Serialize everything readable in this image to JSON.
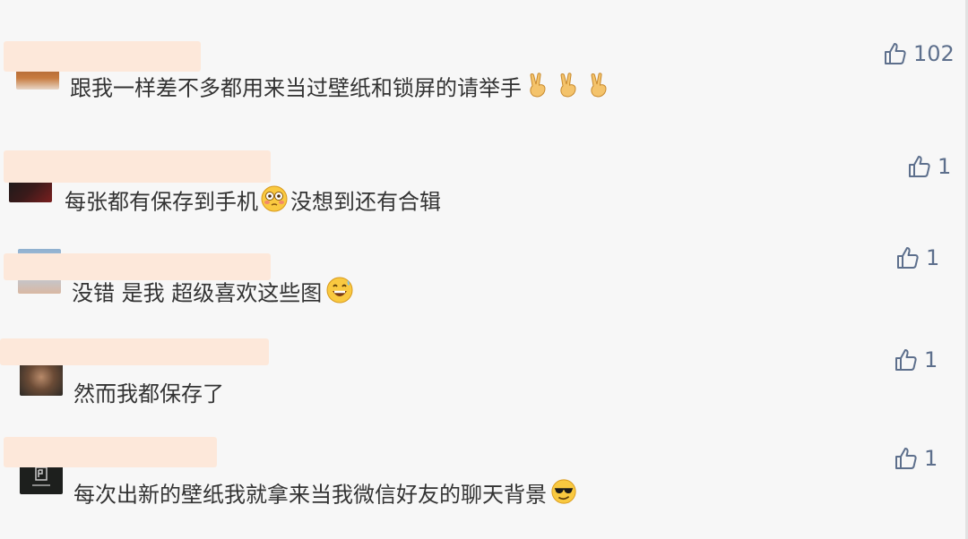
{
  "comments": [
    {
      "text": "跟我一样差不多都用来当过壁纸和锁屏的请举手",
      "likes": "102",
      "emojis": [
        "victory-hand-icon",
        "victory-hand-icon",
        "victory-hand-icon"
      ]
    },
    {
      "text_before": "每张都有保存到手机",
      "text_after": "没想到还有合辑",
      "likes": "1",
      "emojis": [
        "flushed-face-icon"
      ]
    },
    {
      "text": "没错 是我 超级喜欢这些图",
      "likes": "1",
      "emojis": [
        "grinning-sweat-face-icon"
      ]
    },
    {
      "text": "然而我都保存了",
      "likes": "1",
      "emojis": []
    },
    {
      "text": "每次出新的壁纸我就拿来当我微信好友的聊天背景",
      "likes": "1",
      "emojis": [
        "sunglasses-face-icon"
      ]
    }
  ],
  "icons": {
    "like": "thumbs-up-outline-icon"
  },
  "colors": {
    "mask": "#fde8da",
    "likes": "#5d6f8c",
    "text": "#333333",
    "background": "#f7f7f7"
  }
}
